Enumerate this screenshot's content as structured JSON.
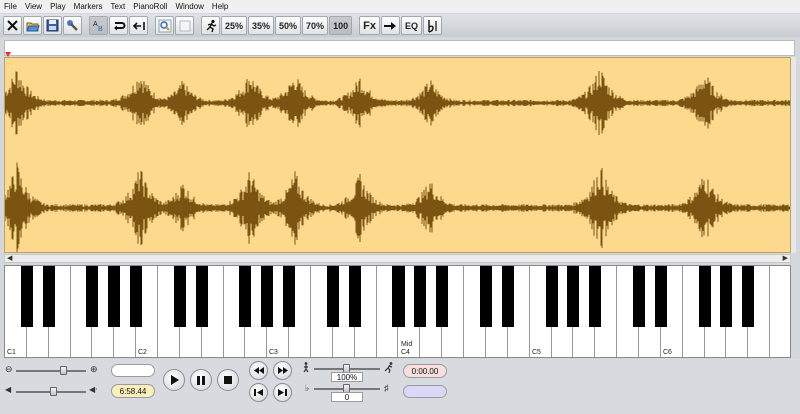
{
  "menu": {
    "items": [
      "File",
      "View",
      "Play",
      "Markers",
      "Text",
      "PianoRoll",
      "Window",
      "Help"
    ]
  },
  "toolbar": {
    "speed_25": "25%",
    "speed_35": "35%",
    "speed_50": "50%",
    "speed_70": "70%",
    "speed_100": "100",
    "fx": "Fx",
    "eq": "EQ"
  },
  "piano": {
    "labels": {
      "c1": "C1",
      "c2": "C2",
      "c3": "C3",
      "mid": "Mid",
      "c4": "C4",
      "c5": "C5",
      "c6": "C6"
    }
  },
  "transport": {
    "position_display": "",
    "duration": "6:58.44",
    "speed_percent": "100%",
    "pitch_value": "0",
    "time_display": "0:00.00",
    "colors": {
      "duration_bg": "#fbeebc",
      "time_bg": "#f8dede",
      "blank_bg": "#d9d9f7"
    }
  },
  "waveform": {
    "background": "#fcd98d",
    "color": "#7a5410"
  },
  "icons": {
    "toolbar": [
      "close-icon",
      "open-icon",
      "save-icon",
      "settings-wrench-icon",
      "text-recognize-icon",
      "loop-icon",
      "marker-icon",
      "zoom-icon",
      "blank-icon",
      "running-speed-icon",
      "effects-icon",
      "skip-icon",
      "equalizer-icon",
      "pitch-icon"
    ]
  }
}
